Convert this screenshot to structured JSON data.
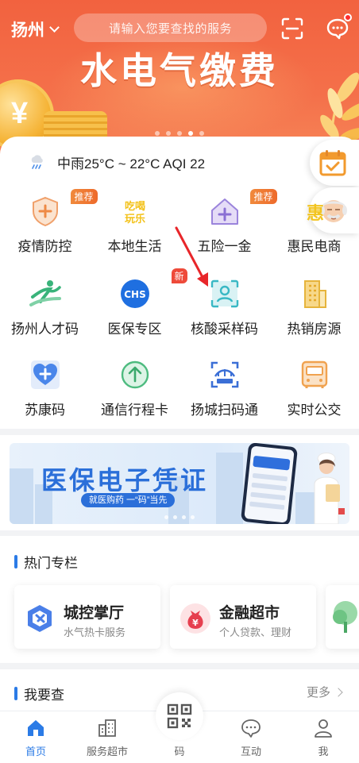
{
  "header": {
    "city": "扬州",
    "search_placeholder": "请输入您要查找的服务",
    "banner_title": "水电气缴费",
    "banner_dots": 5,
    "banner_active_dot": 4
  },
  "weather": {
    "text": "中雨25°C ~ 22°C AQI 22",
    "icon": "rain-icon"
  },
  "services": [
    {
      "label": "疫情防控",
      "icon": "shield-plus-icon",
      "badge": "推荐"
    },
    {
      "label": "本地生活",
      "icon": "local-life-icon",
      "badge": ""
    },
    {
      "label": "五险一金",
      "icon": "house-plus-icon",
      "badge": "推荐"
    },
    {
      "label": "惠民电商",
      "icon": "ecommerce-icon",
      "badge": ""
    },
    {
      "label": "扬州人才码",
      "icon": "runner-icon",
      "badge": ""
    },
    {
      "label": "医保专区",
      "icon": "chs-icon",
      "badge": "新"
    },
    {
      "label": "核酸采样码",
      "icon": "face-scan-icon",
      "badge": ""
    },
    {
      "label": "热销房源",
      "icon": "building-icon",
      "badge": ""
    },
    {
      "label": "苏康码",
      "icon": "heart-plus-icon",
      "badge": ""
    },
    {
      "label": "通信行程卡",
      "icon": "arrow-up-circle-icon",
      "badge": ""
    },
    {
      "label": "扬城扫码通",
      "icon": "scan-bridge-icon",
      "badge": ""
    },
    {
      "label": "实时公交",
      "icon": "bus-icon",
      "badge": ""
    }
  ],
  "promo": {
    "title": "医保电子凭证",
    "subtitle": "就医购药 一“码”当先",
    "dots": 4
  },
  "hot": {
    "title": "热门专栏",
    "cards": [
      {
        "title": "城控掌厅",
        "subtitle": "水气热卡服务",
        "icon": "city-control-icon"
      },
      {
        "title": "金融超市",
        "subtitle": "个人贷款、理财",
        "icon": "money-bag-icon"
      }
    ]
  },
  "check": {
    "title": "我要查",
    "more": "更多"
  },
  "tabbar": [
    {
      "label": "首页",
      "icon": "home-icon",
      "active": true
    },
    {
      "label": "服务超市",
      "icon": "buildings-icon",
      "active": false
    },
    {
      "label": "码",
      "icon": "qr-code-icon",
      "active": false
    },
    {
      "label": "互动",
      "icon": "chat-icon",
      "active": false
    },
    {
      "label": "我",
      "icon": "user-icon",
      "active": false
    }
  ],
  "colors": {
    "banner": "#f2623f",
    "accent_blue": "#2b7be6",
    "badge_orange": "#ee6a2b",
    "badge_red": "#ee4a3a"
  }
}
